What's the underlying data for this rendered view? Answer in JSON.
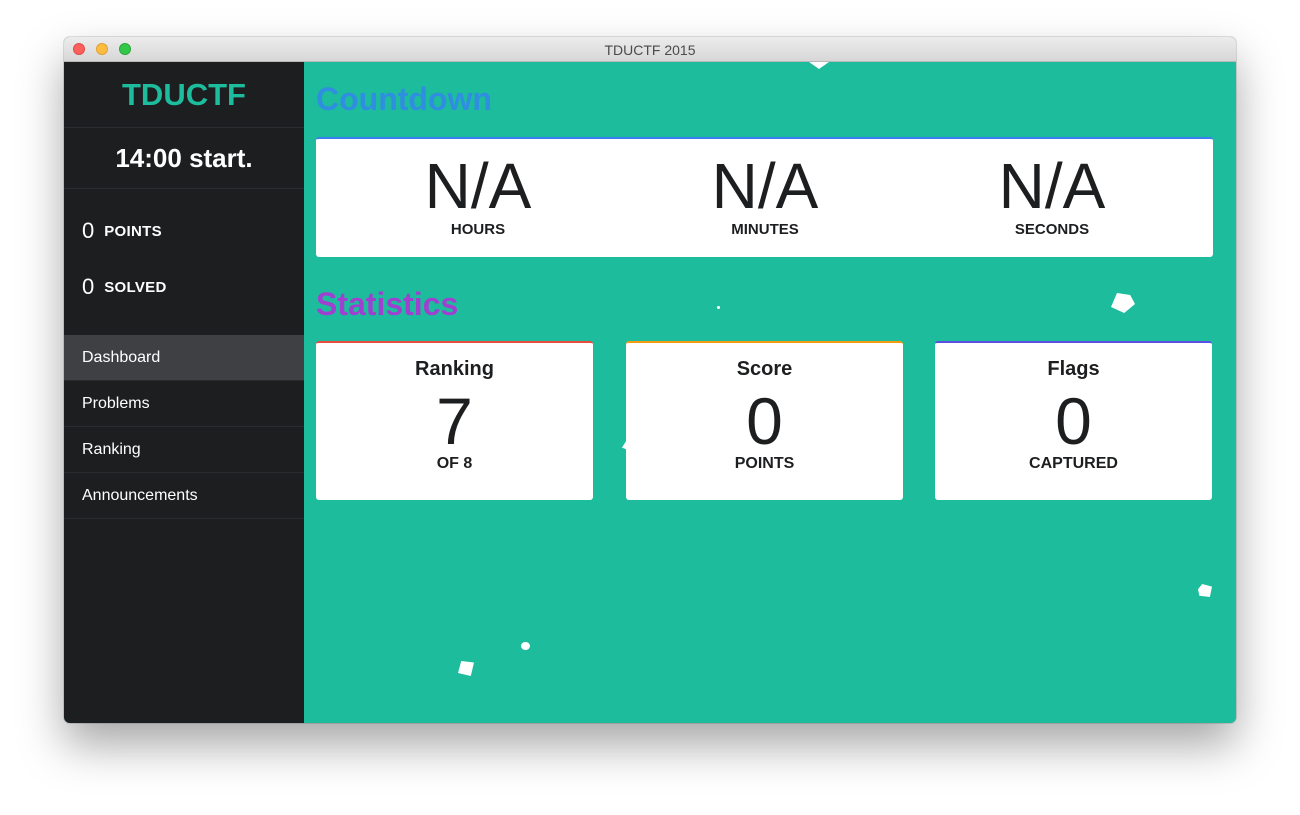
{
  "window": {
    "title": "TDUCTF 2015"
  },
  "sidebar": {
    "brand": "TDUCTF",
    "start_time": "14:00 start.",
    "points": {
      "value": "0",
      "label": "POINTS"
    },
    "solved": {
      "value": "0",
      "label": "SOLVED"
    },
    "nav": [
      {
        "label": "Dashboard",
        "active": true
      },
      {
        "label": "Problems"
      },
      {
        "label": "Ranking"
      },
      {
        "label": "Announcements"
      }
    ]
  },
  "countdown": {
    "title": "Countdown",
    "hours": {
      "value": "N/A",
      "label": "HOURS"
    },
    "minutes": {
      "value": "N/A",
      "label": "MINUTES"
    },
    "seconds": {
      "value": "N/A",
      "label": "SECONDS"
    }
  },
  "statistics": {
    "title": "Statistics",
    "cards": [
      {
        "title": "Ranking",
        "value": "7",
        "sub": "OF 8",
        "accent": "#e74c3c"
      },
      {
        "title": "Score",
        "value": "0",
        "sub": "POINTS",
        "accent": "#f39c12"
      },
      {
        "title": "Flags",
        "value": "0",
        "sub": "CAPTURED",
        "accent": "#5a4fe0"
      }
    ]
  },
  "colors": {
    "background": "#1cbc9c",
    "sidebar": "#1d1e20",
    "brand": "#1cbc9c",
    "countdown_title": "#2f8ee0",
    "statistics_title": "#a040d0"
  }
}
